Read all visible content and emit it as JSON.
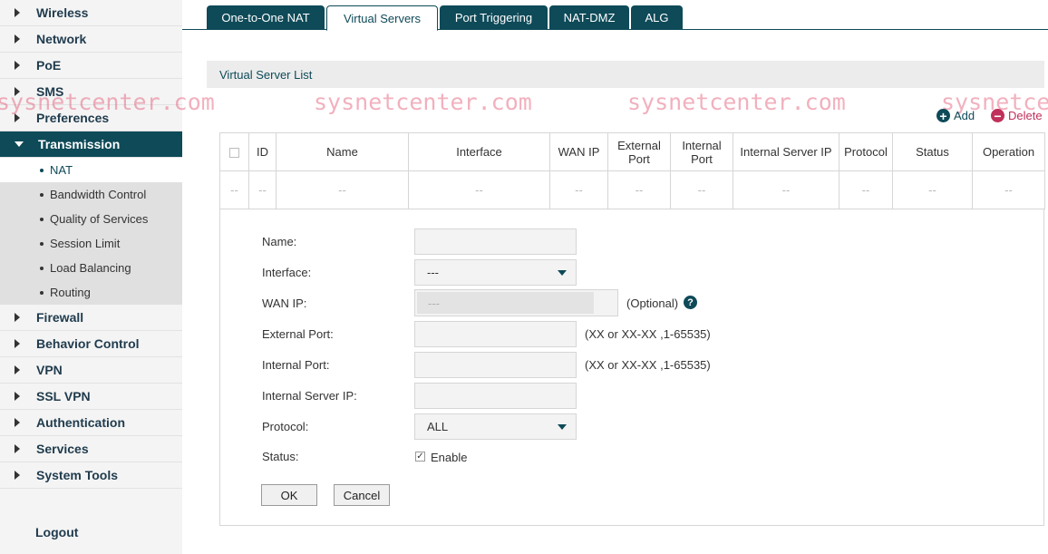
{
  "sidebar": {
    "items_before": [
      {
        "label": "Wireless"
      },
      {
        "label": "Network"
      },
      {
        "label": "PoE"
      },
      {
        "label": "SMS"
      },
      {
        "label": "Preferences"
      }
    ],
    "active_item": {
      "label": "Transmission"
    },
    "sub_items": [
      {
        "label": "NAT",
        "active": true
      },
      {
        "label": "Bandwidth Control"
      },
      {
        "label": "Quality of Services"
      },
      {
        "label": "Session Limit"
      },
      {
        "label": "Load Balancing"
      },
      {
        "label": "Routing"
      }
    ],
    "items_after": [
      {
        "label": "Firewall"
      },
      {
        "label": "Behavior Control"
      },
      {
        "label": "VPN"
      },
      {
        "label": "SSL VPN"
      },
      {
        "label": "Authentication"
      },
      {
        "label": "Services"
      },
      {
        "label": "System Tools"
      }
    ],
    "logout": "Logout"
  },
  "tabs": [
    {
      "label": "One-to-One NAT"
    },
    {
      "label": "Virtual Servers",
      "active": true
    },
    {
      "label": "Port Triggering"
    },
    {
      "label": "NAT-DMZ"
    },
    {
      "label": "ALG"
    }
  ],
  "section_title": "Virtual Server List",
  "watermark": "sysnetcenter.com",
  "actions": {
    "add": "Add",
    "delete": "Delete"
  },
  "table": {
    "headers": [
      "ID",
      "Name",
      "Interface",
      "WAN IP",
      "External Port",
      "Internal Port",
      "Internal Server IP",
      "Protocol",
      "Status",
      "Operation"
    ],
    "empty_row": [
      "--",
      "--",
      "--",
      "--",
      "--",
      "--",
      "--",
      "--",
      "--",
      "--",
      "--"
    ]
  },
  "form": {
    "name_label": "Name:",
    "interface_label": "Interface:",
    "interface_value": "---",
    "wan_ip_label": "WAN IP:",
    "wan_ip_value": "---",
    "wan_ip_hint": "(Optional)",
    "external_port_label": "External Port:",
    "external_port_hint": "(XX or XX-XX ,1-65535)",
    "internal_port_label": "Internal Port:",
    "internal_port_hint": "(XX or XX-XX ,1-65535)",
    "internal_server_ip_label": "Internal Server IP:",
    "protocol_label": "Protocol:",
    "protocol_value": "ALL",
    "status_label": "Status:",
    "enable_label": "Enable",
    "enable_checked": true,
    "ok": "OK",
    "cancel": "Cancel"
  },
  "colors": {
    "accent": "#0e4a58",
    "delete": "#c0305a",
    "watermark": "#e2506e"
  }
}
